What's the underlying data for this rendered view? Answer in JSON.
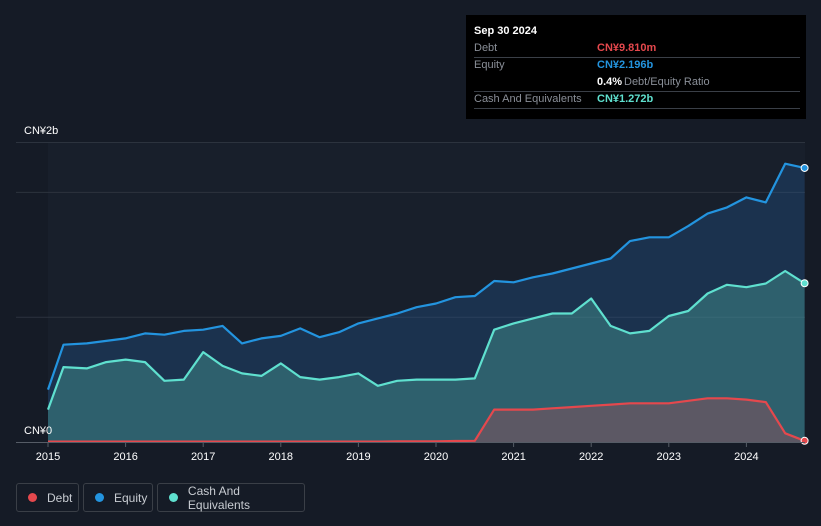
{
  "tooltip": {
    "date": "Sep 30 2024",
    "debt_label": "Debt",
    "debt_value": "CN¥9.810m",
    "equity_label": "Equity",
    "equity_value": "CN¥2.196b",
    "ratio_value": "0.4%",
    "ratio_label": "Debt/Equity Ratio",
    "cash_label": "Cash And Equivalents",
    "cash_value": "CN¥1.272b"
  },
  "legend": [
    {
      "label": "Debt",
      "color": "#e5484d"
    },
    {
      "label": "Equity",
      "color": "#2394df"
    },
    {
      "label": "Cash And Equivalents",
      "color": "#5fe0cf"
    }
  ],
  "chart_data": {
    "type": "area",
    "ylabel_top": "CN¥2b",
    "ylabel_bottom": "CN¥0",
    "ylim": [
      0,
      2.4
    ],
    "xlim": [
      2014.6,
      2024.8
    ],
    "x_ticks": [
      "2015",
      "2016",
      "2017",
      "2018",
      "2019",
      "2020",
      "2021",
      "2022",
      "2023",
      "2024"
    ],
    "x": [
      2015,
      2015.2,
      2015.5,
      2015.75,
      2016,
      2016.25,
      2016.5,
      2016.75,
      2017,
      2017.25,
      2017.5,
      2017.75,
      2018,
      2018.25,
      2018.5,
      2018.75,
      2019,
      2019.25,
      2019.5,
      2019.75,
      2020,
      2020.25,
      2020.5,
      2020.75,
      2021,
      2021.25,
      2021.5,
      2021.75,
      2022,
      2022.25,
      2022.5,
      2022.75,
      2023,
      2023.25,
      2023.5,
      2023.75,
      2024,
      2024.25,
      2024.5,
      2024.75
    ],
    "series": [
      {
        "name": "Equity",
        "unit": "CN¥b",
        "values": [
          0.42,
          0.78,
          0.79,
          0.81,
          0.83,
          0.87,
          0.86,
          0.89,
          0.9,
          0.93,
          0.79,
          0.83,
          0.85,
          0.91,
          0.84,
          0.88,
          0.95,
          0.99,
          1.03,
          1.08,
          1.11,
          1.16,
          1.17,
          1.29,
          1.28,
          1.32,
          1.35,
          1.39,
          1.43,
          1.47,
          1.61,
          1.64,
          1.64,
          1.73,
          1.83,
          1.88,
          1.96,
          1.92,
          2.23,
          2.196
        ]
      },
      {
        "name": "Cash And Equivalents",
        "unit": "CN¥b",
        "values": [
          0.26,
          0.6,
          0.59,
          0.64,
          0.66,
          0.64,
          0.49,
          0.5,
          0.72,
          0.61,
          0.55,
          0.53,
          0.63,
          0.52,
          0.5,
          0.52,
          0.55,
          0.45,
          0.49,
          0.5,
          0.5,
          0.5,
          0.51,
          0.9,
          0.95,
          0.99,
          1.03,
          1.03,
          1.15,
          0.93,
          0.87,
          0.89,
          1.01,
          1.05,
          1.19,
          1.26,
          1.24,
          1.27,
          1.37,
          1.272
        ]
      },
      {
        "name": "Debt",
        "unit": "CN¥b",
        "values": [
          0.003,
          0.003,
          0.003,
          0.003,
          0.003,
          0.003,
          0.003,
          0.003,
          0.003,
          0.003,
          0.003,
          0.003,
          0.003,
          0.003,
          0.003,
          0.003,
          0.003,
          0.003,
          0.005,
          0.005,
          0.005,
          0.008,
          0.01,
          0.26,
          0.26,
          0.26,
          0.27,
          0.28,
          0.29,
          0.3,
          0.31,
          0.31,
          0.31,
          0.33,
          0.35,
          0.35,
          0.34,
          0.32,
          0.07,
          0.0098
        ]
      }
    ]
  }
}
